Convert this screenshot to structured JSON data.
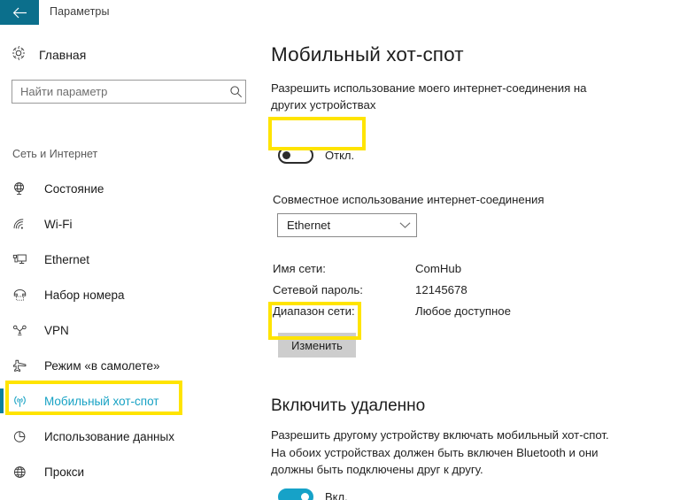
{
  "window": {
    "title": "Параметры",
    "back_icon": "back-arrow-icon",
    "accent_teal": "#0b6f8c",
    "accent_cyan": "#16a2c8",
    "highlight_yellow": "#ffe400"
  },
  "sidebar": {
    "home": {
      "label": "Главная",
      "icon": "gear-icon"
    },
    "search": {
      "value": "",
      "placeholder": "Найти параметр",
      "icon": "search-icon"
    },
    "group_label": "Сеть и Интернет",
    "items": [
      {
        "label": "Состояние",
        "icon": "globe-status-icon",
        "selected": false
      },
      {
        "label": "Wi-Fi",
        "icon": "wifi-icon",
        "selected": false
      },
      {
        "label": "Ethernet",
        "icon": "ethernet-monitor-icon",
        "selected": false
      },
      {
        "label": "Набор номера",
        "icon": "phone-handset-icon",
        "selected": false
      },
      {
        "label": "VPN",
        "icon": "vpn-key-icon",
        "selected": false
      },
      {
        "label": "Режим «в самолете»",
        "icon": "airplane-icon",
        "selected": false
      },
      {
        "label": "Мобильный хот-спот",
        "icon": "hotspot-broadcast-icon",
        "selected": true
      },
      {
        "label": "Использование данных",
        "icon": "pie-chart-icon",
        "selected": false
      },
      {
        "label": "Прокси",
        "icon": "globe-icon",
        "selected": false
      }
    ]
  },
  "main": {
    "heading": "Мобильный хот-спот",
    "share_description": "Разрешить использование моего интернет-соединения на других устройствах",
    "share_toggle": {
      "state_label": "Откл.",
      "on": false
    },
    "connection_sharing_label": "Совместное использование интернет-соединения",
    "connection_dropdown": {
      "value": "Ethernet",
      "chevron_icon": "chevron-down-icon",
      "options": [
        "Ethernet"
      ]
    },
    "info_rows": [
      {
        "key": "Имя сети:",
        "value": "ComHub"
      },
      {
        "key": "Сетевой пароль:",
        "value": "12145678"
      },
      {
        "key": "Диапазон сети:",
        "value": "Любое доступное"
      }
    ],
    "edit_button_label": "Изменить",
    "remote_heading": "Включить удаленно",
    "remote_description": "Разрешить другому устройству включать мобильный хот-спот. На обоих устройствах должен быть включен Bluetooth и они должны быть подключены друг к другу.",
    "remote_toggle": {
      "state_label": "Вкл.",
      "on": true
    }
  },
  "annotations": [
    {
      "name": "highlight-share-toggle"
    },
    {
      "name": "highlight-edit-button"
    },
    {
      "name": "highlight-sidebar-hotspot"
    }
  ]
}
